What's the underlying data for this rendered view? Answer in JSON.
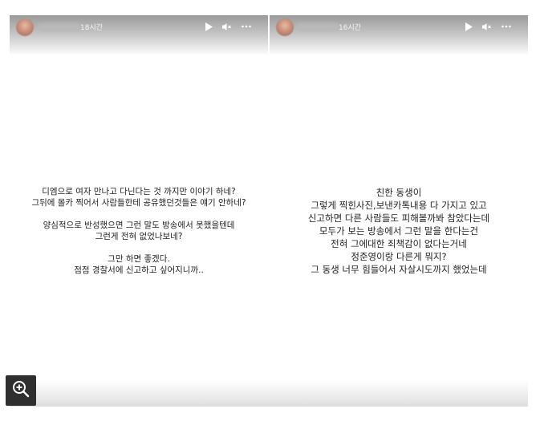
{
  "left_story": {
    "time": "18시간",
    "lines": [
      "디엠으로 여자 만나고 다닌다는 것 까지만 이야기 하네?",
      "그뒤에 몰카 찍어서 사람들한테 공유했던것들은 얘기 안하네?",
      "",
      "양심적으로 반성했으면 그런 말도 방송에서 못했을텐데",
      "그런게 전혀 없었나보네?",
      "",
      "그만 하면 좋겠다.",
      "점점 경찰서에 신고하고 싶어지니까.."
    ]
  },
  "right_story": {
    "time": "16시간",
    "lines": [
      "친한 동생이",
      "그렇게 찍힌사진,보낸카톡내용 다 가지고 있고",
      "신고하면 다른 사람들도 피해볼까봐 참았다는데",
      "모두가 보는 방송에서 그런 말을 한다는건",
      "전혀 그에대한 죄책감이 없다는거네",
      "정준영이랑 다른게 뭐지?",
      "그 동생 너무 힘들어서 자살시도까지 했었는데"
    ]
  },
  "icons": {
    "play": "play-icon",
    "mute": "volume-muted-icon",
    "more": "more-icon",
    "zoom": "zoom-in-icon"
  },
  "colors": {
    "text": "#222222",
    "header_top": "#9a9a9a",
    "zoom_bg": "#2f2f2f"
  }
}
